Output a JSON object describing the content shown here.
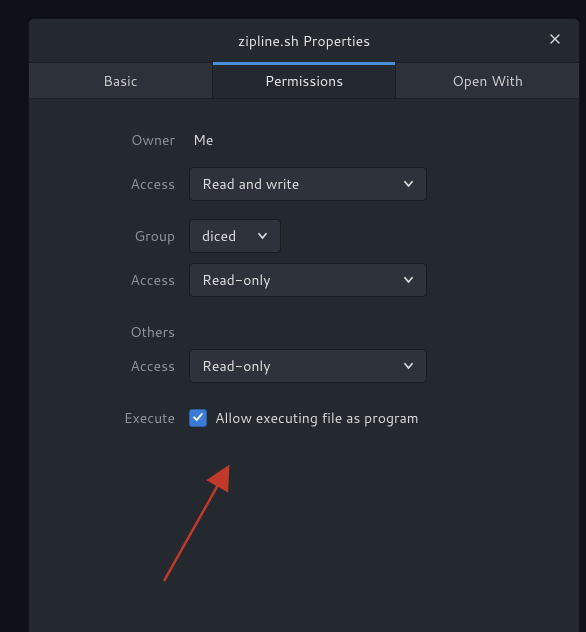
{
  "window": {
    "title": "zipline.sh Properties"
  },
  "tabs": {
    "basic": "Basic",
    "permissions": "Permissions",
    "open_with": "Open With"
  },
  "permissions": {
    "owner_label": "Owner",
    "owner_value": "Me",
    "owner_access_label": "Access",
    "owner_access_value": "Read and write",
    "group_label": "Group",
    "group_value": "diced",
    "group_access_label": "Access",
    "group_access_value": "Read-only",
    "others_label": "Others",
    "others_access_label": "Access",
    "others_access_value": "Read-only",
    "execute_label": "Execute",
    "execute_checkbox_label": "Allow executing file as program",
    "execute_checked": true
  }
}
